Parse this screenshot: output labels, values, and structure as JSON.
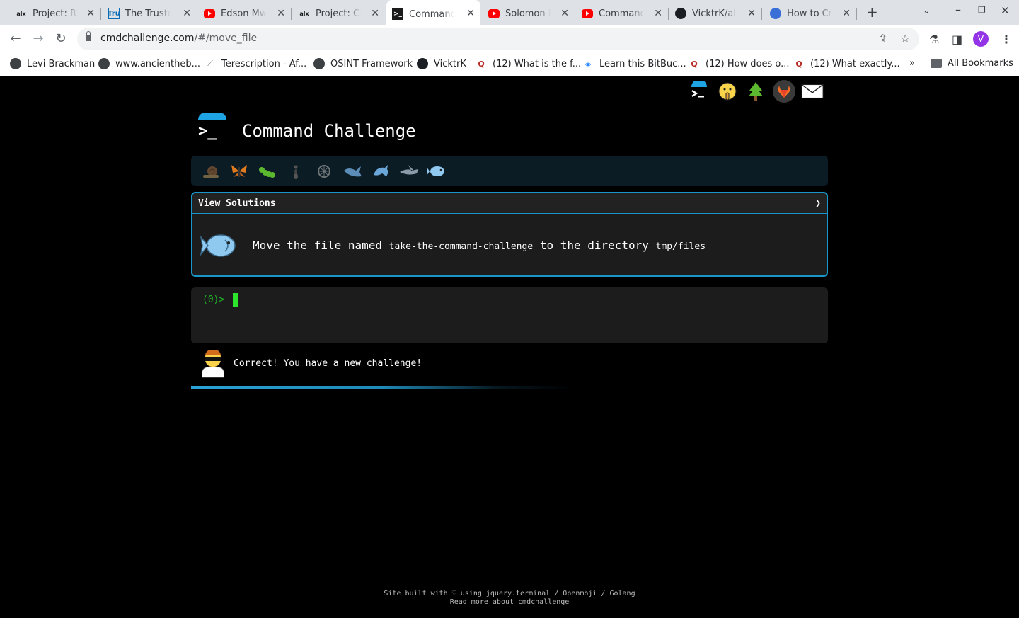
{
  "browser": {
    "tabs": [
      {
        "title": "Project: RSA",
        "favicon": "alx-icon"
      },
      {
        "title": "The Trusted",
        "favicon": "tru-icon"
      },
      {
        "title": "Edson Mwa",
        "favicon": "youtube-icon"
      },
      {
        "title": "Project: Co",
        "favicon": "alx-icon"
      },
      {
        "title": "Command",
        "favicon": "terminal-icon",
        "active": true
      },
      {
        "title": "Solomon M",
        "favicon": "youtube-icon"
      },
      {
        "title": "Command",
        "favicon": "youtube-icon"
      },
      {
        "title": "VicktrK/alx",
        "favicon": "github-icon"
      },
      {
        "title": "How to Cre",
        "favicon": "globe-icon"
      }
    ],
    "url_host": "cmdchallenge.com",
    "url_path": "/#/move_file",
    "profile_initial": "V",
    "bookmarks": [
      {
        "label": "Levi Brackman",
        "icon": "globe-icon"
      },
      {
        "label": "www.ancientheb...",
        "icon": "globe-icon"
      },
      {
        "label": "Terescription - Af...",
        "icon": "feather-icon"
      },
      {
        "label": "OSINT Framework",
        "icon": "globe-icon"
      },
      {
        "label": "VicktrK",
        "icon": "github-icon"
      },
      {
        "label": "(12) What is the f...",
        "icon": "quora-icon"
      },
      {
        "label": "Learn this BitBuc...",
        "icon": "bitbucket-icon"
      },
      {
        "label": "(12) How does o...",
        "icon": "quora-icon"
      },
      {
        "label": "(12) What exactly...",
        "icon": "quora-icon"
      }
    ],
    "overflow_label": "»",
    "all_bookmarks": "All Bookmarks"
  },
  "page": {
    "title": "Command Challenge",
    "logo_prompt": ">_",
    "view_solutions": "View Solutions",
    "challenge": {
      "prefix": "Move the file named",
      "file": "take-the-command-challenge",
      "middle": "to the directory",
      "dir": "tmp/files"
    },
    "prompt": "(0)>",
    "result_message": "Correct! You have a new challenge!",
    "progress": 0.6,
    "footer_line1": "Site built with ♡ using jquery.terminal / Openmoji / Golang",
    "footer_line2": "Read more about cmdchallenge",
    "level_icons": [
      "snail-icon",
      "butterfly-icon",
      "caterpillar-icon",
      "ant-icon",
      "wheel-icon",
      "whale-icon",
      "dolphin-icon",
      "shark-icon",
      "fish-icon"
    ]
  }
}
